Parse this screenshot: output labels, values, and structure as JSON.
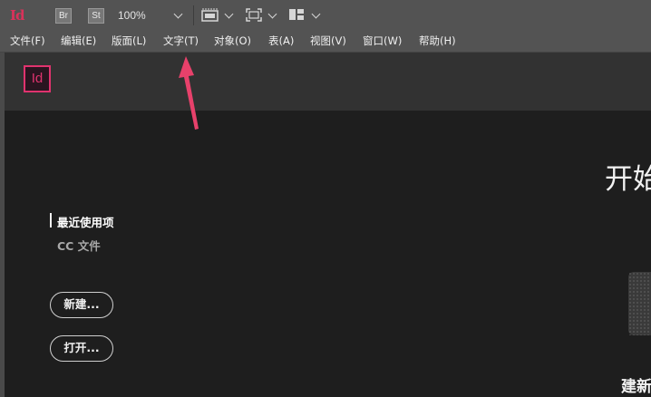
{
  "toolbar": {
    "app_logo": "Id",
    "bridge_label": "Br",
    "stock_label": "St",
    "zoom_value": "100%",
    "icons": [
      "screen-mode-icon",
      "view-options-icon",
      "arrange-documents-icon"
    ]
  },
  "menubar": {
    "items": [
      {
        "label": "文件(F)"
      },
      {
        "label": "编辑(E)"
      },
      {
        "label": "版面(L)"
      },
      {
        "label": "文字(T)"
      },
      {
        "label": "对象(O)"
      },
      {
        "label": "表(A)"
      },
      {
        "label": "视图(V)"
      },
      {
        "label": "窗口(W)"
      },
      {
        "label": "帮助(H)"
      }
    ]
  },
  "start": {
    "logo": "Id",
    "title": "开始",
    "nav": {
      "recent": "最近使用项",
      "cc_files": "CC 文件"
    },
    "buttons": {
      "new": "新建...",
      "open": "打开..."
    },
    "bottom_partial": "建新"
  },
  "colors": {
    "brand": "#e0336e",
    "toolbar_bg": "#535353",
    "content_bg": "#1e1e1e",
    "header_bg": "#323232",
    "annotation": "#e8416b"
  }
}
